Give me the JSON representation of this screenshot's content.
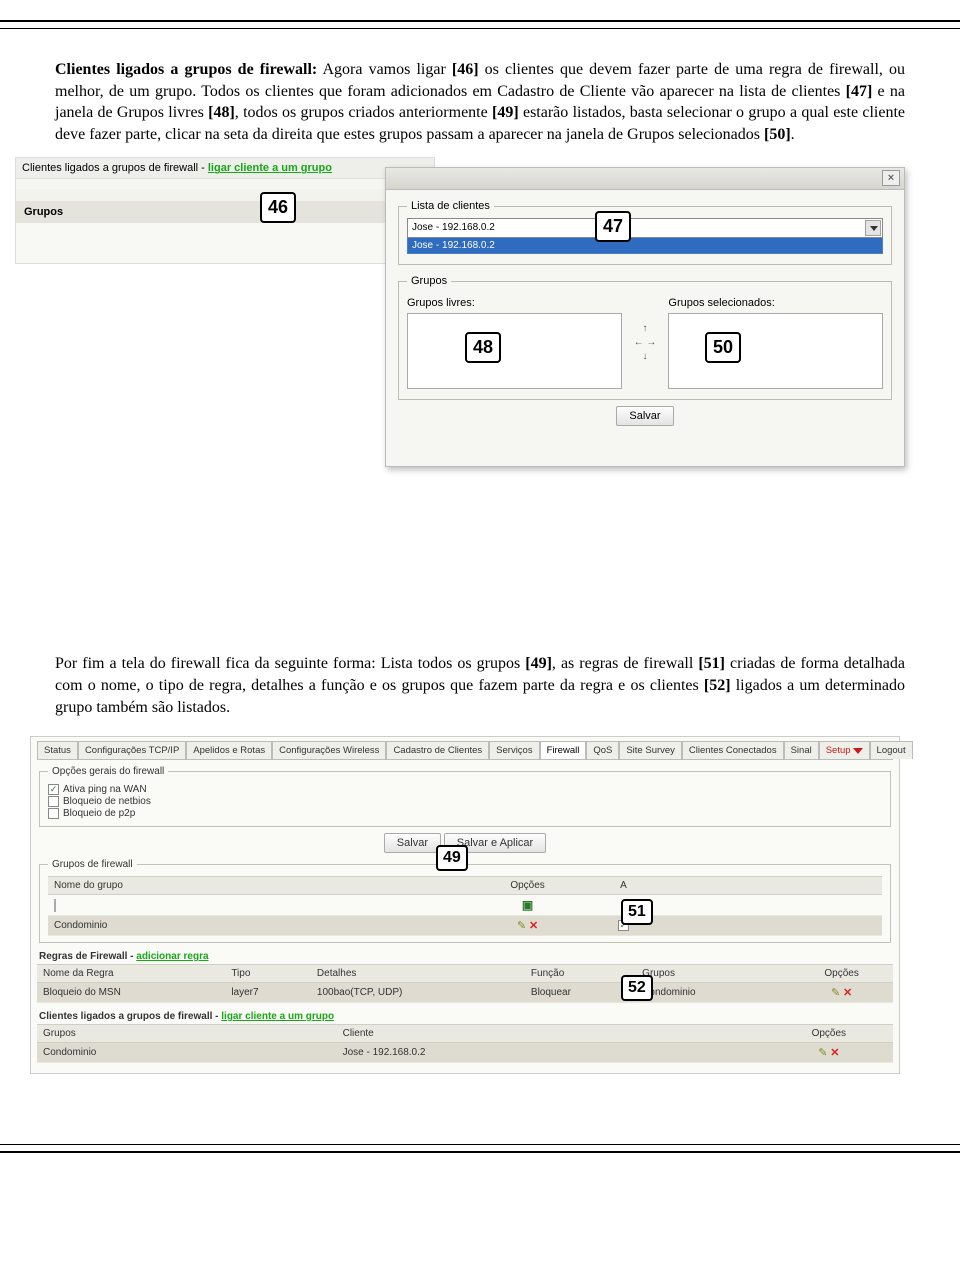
{
  "para1": {
    "bold_intro": "Clientes ligados a grupos de firewall:",
    "text": " Agora vamos ligar ",
    "ref46": "[46]",
    "text2": " os clientes que devem fazer parte de uma regra de firewall, ou melhor, de um grupo. Todos os clientes que foram adicionados em Cadastro de Cliente vão aparecer na lista de clientes ",
    "ref47": "[47]",
    "text3": " e na janela de Grupos livres ",
    "ref48": "[48]",
    "text4": ", todos os grupos criados anteriormente ",
    "ref49": "[49]",
    "text5": " estarão listados, basta selecionar o grupo a qual este cliente deve fazer parte, clicar na seta da direita que estes grupos passam a aparecer na janela de Grupos selecionados ",
    "ref50": "[50]",
    "text6": "."
  },
  "shot1": {
    "left_title_prefix": "Clientes ligados a grupos de firewall - ",
    "left_title_link": "ligar cliente a um grupo",
    "grupos_label": "Grupos",
    "dialog": {
      "close": "×",
      "fs1_legend": "Lista de clientes",
      "combo_value": "Jose - 192.168.0.2",
      "combo_option": "Jose - 192.168.0.2",
      "fs2_legend": "Grupos",
      "free_label": "Grupos livres:",
      "sel_label": "Grupos selecionados:",
      "save": "Salvar"
    },
    "annots": {
      "a46": "46",
      "a47": "47",
      "a48": "48",
      "a50": "50"
    }
  },
  "para2": {
    "text1": "Por fim a tela do firewall fica da seguinte forma: Lista todos os grupos ",
    "ref49": "[49]",
    "text2": ", as regras de firewall ",
    "ref51": "[51]",
    "text3": " criadas de forma detalhada com o nome, o tipo de regra, detalhes a função e os grupos que fazem parte da regra e os clientes ",
    "ref52": "[52]",
    "text4": " ligados a um determinado grupo também são listados."
  },
  "shot2": {
    "tabs": [
      "Status",
      "Configurações TCP/IP",
      "Apelidos e Rotas",
      "Configurações Wireless",
      "Cadastro de Clientes",
      "Serviços",
      "Firewall",
      "QoS",
      "Site Survey",
      "Clientes Conectados",
      "Sinal",
      "Setup",
      "Logout"
    ],
    "opts_legend": "Opções gerais do firewall",
    "opts": [
      "Ativa ping na WAN",
      "Bloqueio de netbios",
      "Bloqueio de p2p"
    ],
    "btn_save": "Salvar",
    "btn_apply": "Salvar e Aplicar",
    "grp_legend": "Grupos de firewall",
    "grp_headers": [
      "Nome do grupo",
      "Opções",
      "A"
    ],
    "grp_row_name": "Condominio",
    "rules_title_prefix": "Regras de Firewall - ",
    "rules_title_link": "adicionar regra",
    "rules_headers": [
      "Nome da Regra",
      "Tipo",
      "Detalhes",
      "Função",
      "Grupos",
      "Opções"
    ],
    "rules_row": {
      "name": "Bloqueio do MSN",
      "type": "layer7",
      "details": "100bao(TCP, UDP)",
      "func": "Bloquear",
      "groups": "Condominio"
    },
    "clients_title_prefix": "Clientes ligados a grupos de firewall - ",
    "clients_title_link": "ligar cliente a um grupo",
    "clients_headers": [
      "Grupos",
      "Cliente",
      "Opções"
    ],
    "clients_row": {
      "group": "Condominio",
      "client": "Jose - 192.168.0.2"
    },
    "annots": {
      "a49": "49",
      "a51": "51",
      "a52": "52"
    }
  }
}
